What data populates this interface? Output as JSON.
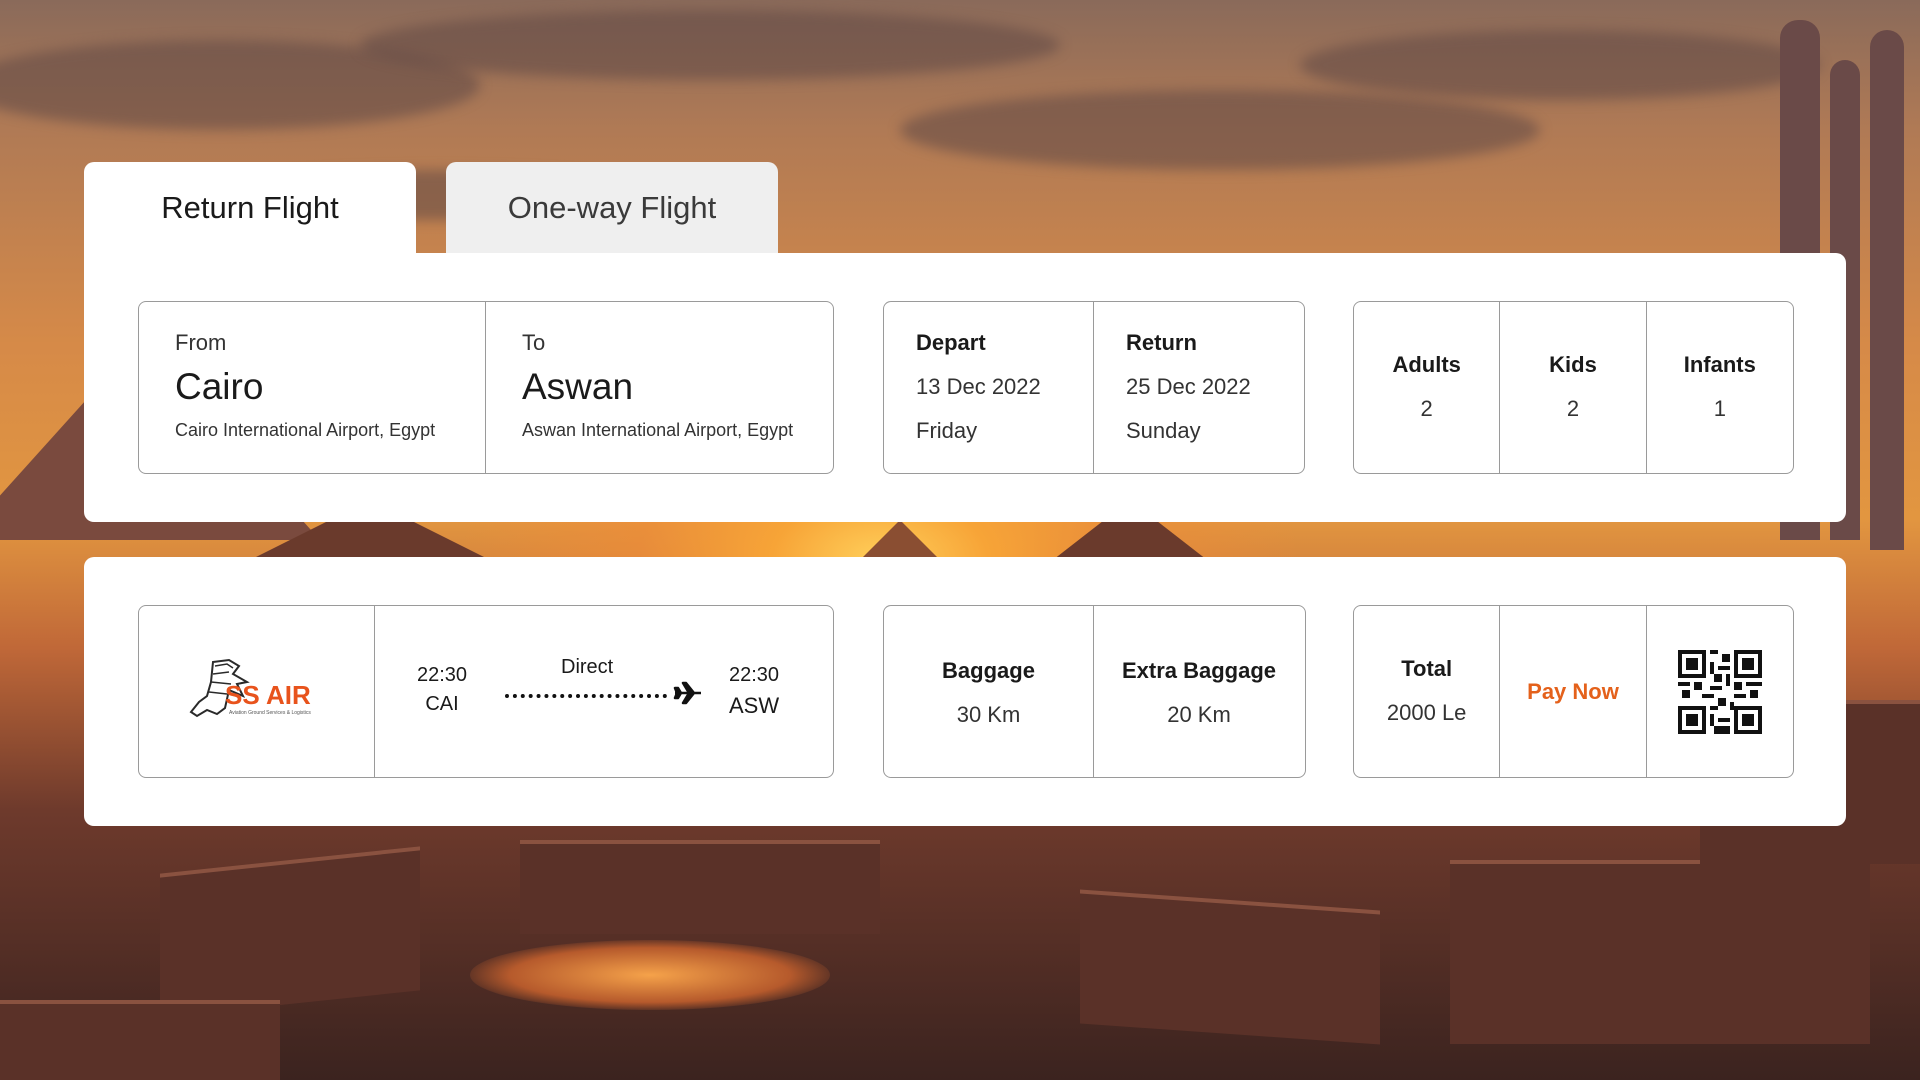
{
  "tabs": [
    {
      "label": "Return Flight",
      "active": true
    },
    {
      "label": "One-way Flight",
      "active": false
    }
  ],
  "search": {
    "from": {
      "label": "From",
      "city": "Cairo",
      "airport": "Cairo International Airport, Egypt"
    },
    "to": {
      "label": "To",
      "city": "Aswan",
      "airport": "Aswan International Airport, Egypt"
    },
    "depart": {
      "label": "Depart",
      "date": "13 Dec 2022",
      "day": "Friday"
    },
    "return": {
      "label": "Return",
      "date": "25 Dec 2022",
      "day": "Sunday"
    },
    "passengers": [
      {
        "label": "Adults",
        "count": "2"
      },
      {
        "label": "Kids",
        "count": "2"
      },
      {
        "label": "Infants",
        "count": "1"
      }
    ]
  },
  "flight": {
    "airline_logo_text": "SS AIR",
    "airline_tagline": "Aviation Ground Services & Logistics",
    "departure": {
      "time": "22:30",
      "code": "CAI"
    },
    "arrival": {
      "time": "22:30",
      "code": "ASW"
    },
    "stops": "Direct",
    "baggage": {
      "label": "Baggage",
      "value": "30 Km"
    },
    "extra_baggage": {
      "label": "Extra Baggage",
      "value": "20 Km"
    },
    "total": {
      "label": "Total",
      "value": "2000 Le"
    },
    "pay_label": "Pay Now"
  },
  "icons": {
    "plane": "airplane-icon",
    "qr": "qr-code-icon"
  },
  "colors": {
    "accent": "#e4611b",
    "logo_orange": "#e8531c"
  }
}
